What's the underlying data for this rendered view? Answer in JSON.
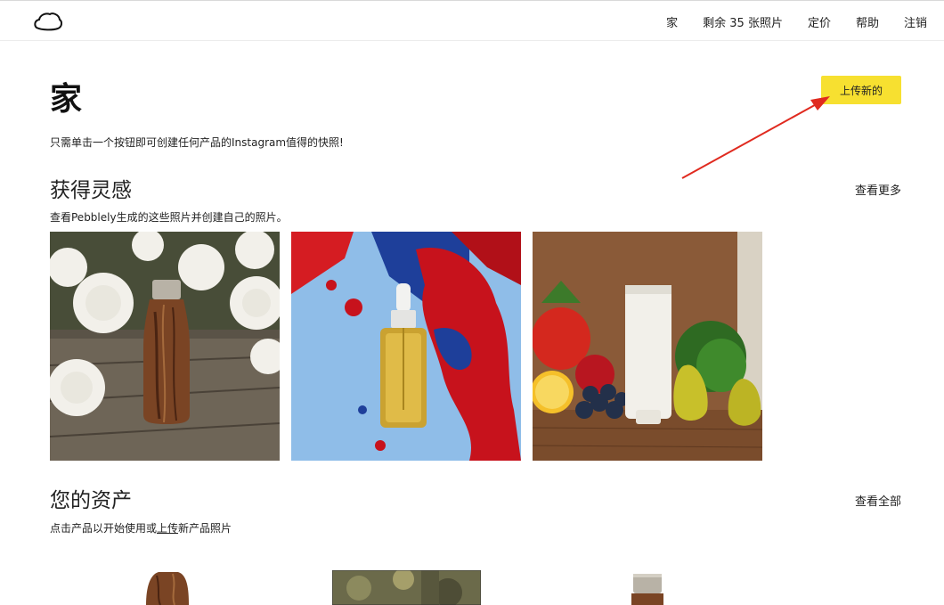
{
  "nav": {
    "links": [
      "家",
      "剩余 35 张照片",
      "定价",
      "帮助",
      "注销"
    ]
  },
  "header": {
    "title": "家",
    "upload_button": "上传新的",
    "subtitle": "只需单击一个按钮即可创建任何产品的Instagram值得的快照!"
  },
  "inspiration": {
    "title": "获得灵感",
    "link": "查看更多",
    "description": "查看Pebblely生成的这些照片并创建自己的照片。"
  },
  "assets": {
    "title": "您的资产",
    "link": "查看全部",
    "description_pre": "点击产品以开始使用或",
    "description_link": "上传",
    "description_post": "新产品照片"
  },
  "colors": {
    "accent": "#f7e030",
    "arrow": "#e02a1f"
  }
}
